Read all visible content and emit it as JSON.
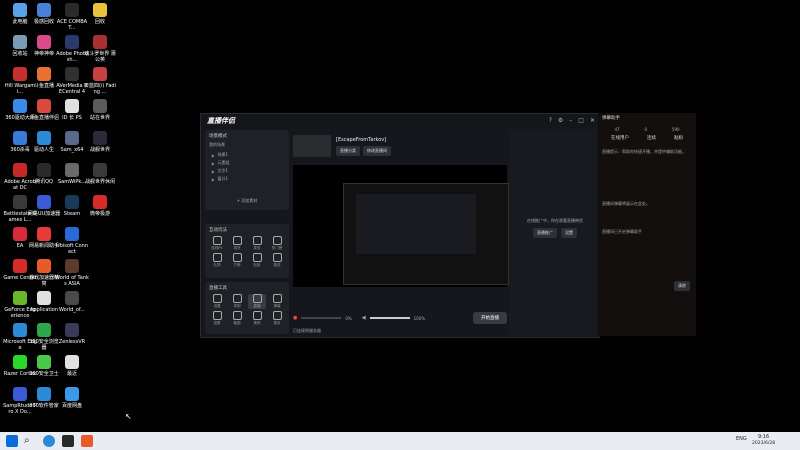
{
  "desktop_icons": [
    {
      "label": "此电脑",
      "color": "#5aa0e8"
    },
    {
      "label": "极感回收",
      "color": "#4a7fd8"
    },
    {
      "label": "ACE COMBAT...",
      "color": "#2b2b2b"
    },
    {
      "label": "回收",
      "color": "#e8c23a"
    },
    {
      "label": "回收站",
      "color": "#7a9bb8"
    },
    {
      "label": "神帝神帝",
      "color": "#d84a8a"
    },
    {
      "label": "Adobe Photosh...",
      "color": "#2a3a6a"
    },
    {
      "label": "魂斗罗世界 蒲公英",
      "color": "#a83030"
    },
    {
      "label": "Hill Wargami...",
      "color": "#c83030"
    },
    {
      "label": "斗鱼直播",
      "color": "#e87030"
    },
    {
      "label": "AVerMedia RECentral 4",
      "color": "#303030"
    },
    {
      "label": "日蓝四(i) Fading ...",
      "color": "#c84040"
    },
    {
      "label": "360驱动大师",
      "color": "#3a8ae8"
    },
    {
      "label": "斗鱼直播伴侣",
      "color": "#d84a40"
    },
    {
      "label": "ID 长 PS",
      "color": "#e0e0e0"
    },
    {
      "label": "站在世界",
      "color": "#5a5a5a"
    },
    {
      "label": "360杀毒",
      "color": "#3a7ad8"
    },
    {
      "label": "驱动人生",
      "color": "#2a8ad8"
    },
    {
      "label": "Sam_x64",
      "color": "#5a6a8a"
    },
    {
      "label": "战舰世界",
      "color": "#2a2a3a"
    },
    {
      "label": "Adobe Acrobat DC",
      "color": "#c82828"
    },
    {
      "label": "腾讯QQ",
      "color": "#2a2a2a"
    },
    {
      "label": "SamWiPk...",
      "color": "#6a6a6a"
    },
    {
      "label": "战舰世界休闲",
      "color": "#3a3a3a"
    },
    {
      "label": "Battlestate Games L...",
      "color": "#3a3a3a"
    },
    {
      "label": "网易UU加速器",
      "color": "#3a5ad8"
    },
    {
      "label": "Steam",
      "color": "#1a3a5a"
    },
    {
      "label": "微帝极游",
      "color": "#d82a2a"
    },
    {
      "label": "EA",
      "color": "#d82a3a"
    },
    {
      "label": "网易新闻助手",
      "color": "#e83a3a"
    },
    {
      "label": "Ubisoft Connect",
      "color": "#2a6ad8"
    },
    {
      "label": "Game Center",
      "color": "#d82a2a"
    },
    {
      "label": "游戏加速器精简",
      "color": "#e85a2a"
    },
    {
      "label": "World of Tanks ASIA",
      "color": "#5a3a2a"
    },
    {
      "label": "GeForce Experience",
      "color": "#6ab82a"
    },
    {
      "label": "Application",
      "color": "#e0e0e0"
    },
    {
      "label": "World_of...",
      "color": "#4a4a4a"
    },
    {
      "label": "Microsoft Edge",
      "color": "#2a8ad8"
    },
    {
      "label": "360安全浏览器",
      "color": "#2aa84a"
    },
    {
      "label": "ZenlessVR",
      "color": "#3a3a5a"
    },
    {
      "label": "Razer Cortex",
      "color": "#2ad82a"
    },
    {
      "label": "360安全卫士",
      "color": "#4ac84a"
    },
    {
      "label": "最近",
      "color": "#e0e0e0"
    },
    {
      "label": "SampRtude Pro X Do...",
      "color": "#3a5ad8"
    },
    {
      "label": "360软件管家",
      "color": "#2a8ad8"
    },
    {
      "label": "百度网盘",
      "color": "#3a9ae8"
    }
  ],
  "app": {
    "logo": "直播伴侣",
    "left": {
      "scene_title": "场景模式",
      "scene_actions": [
        "清理",
        "其他"
      ],
      "sources_title": "我的场景",
      "sources": [
        "场景1",
        "元素组",
        "文字1",
        "窗口1"
      ],
      "add_label": "+ 添加素材",
      "interact_title": "互动玩法",
      "interact_tools": [
        "连线PK",
        "带货",
        "麦序",
        "热门榜",
        "礼物",
        "打榜",
        "贴纸",
        "推送"
      ],
      "live_title": "直播工具",
      "live_tools": [
        "设置",
        "录制",
        "直播",
        "弹幕",
        "投屏",
        "截图",
        "美颜",
        "更多"
      ],
      "more_label": "更多功能"
    },
    "main": {
      "stream_title": "[EscapeFromTarkov]",
      "tag1": "直播分类",
      "tag2": "修改直播间",
      "mic_label": "0%",
      "vol_label": "100%",
      "go_live": "开始直播",
      "status_text": "已连接到服务器"
    },
    "right": {
      "msg": "在线推广中，你在观看直播带货",
      "btn1": "直播推广",
      "btn2": "设置"
    }
  },
  "assistant": {
    "title": "弹幕助手",
    "stats": [
      "在线用户",
      "连续",
      "贴粉"
    ],
    "counts": [
      "47",
      "0",
      "590"
    ],
    "text1": "直播提示：帮助你快速开播，并提供辅助功能。",
    "text2": "直播间弹幕将展示在此处。",
    "text3": "直播间已开启弹幕助手",
    "button": "清除"
  },
  "taskbar": {
    "lang": "ENG",
    "time": "9:16",
    "date": "2023/6/28"
  }
}
